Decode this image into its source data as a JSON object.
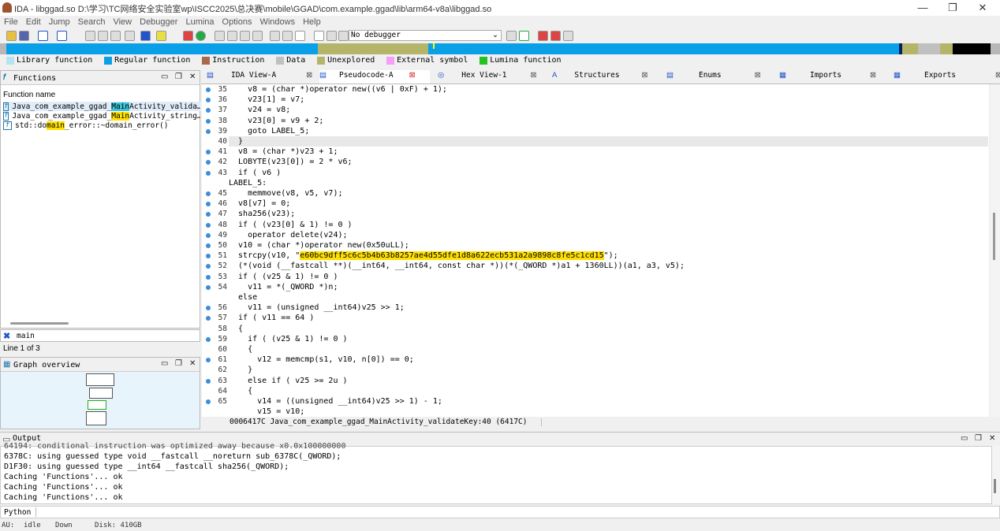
{
  "window": {
    "title": "IDA - libggad.so D:\\学习\\TC网络安全实验室wp\\ISCC2025\\总决赛\\mobile\\GGAD\\com.example.ggad\\lib\\arm64-v8a\\libggad.so",
    "min": "—",
    "max": "❐",
    "close": "✕"
  },
  "menu": [
    "File",
    "Edit",
    "Jump",
    "Search",
    "View",
    "Debugger",
    "Lumina",
    "Options",
    "Windows",
    "Help"
  ],
  "debugger_select": "No debugger",
  "legend": [
    {
      "label": "Library function",
      "color": "#b5e4f0"
    },
    {
      "label": "Regular function",
      "color": "#0aa0e8"
    },
    {
      "label": "Instruction",
      "color": "#a86a4a"
    },
    {
      "label": "Data",
      "color": "#c0c0c0"
    },
    {
      "label": "Unexplored",
      "color": "#b5b56a"
    },
    {
      "label": "External symbol",
      "color": "#f79ef7"
    },
    {
      "label": "Lumina function",
      "color": "#22c422"
    }
  ],
  "functions": {
    "title": "Functions",
    "column": "Function name",
    "items": [
      {
        "pre": "Java_com_example_ggad_",
        "hl": "Main",
        "post": "Activity_valida…",
        "hlclass": "hl-c"
      },
      {
        "pre": "Java_com_example_ggad_",
        "hl": "Main",
        "post": "Activity_string…",
        "hlclass": "hl-y"
      },
      {
        "pre": "std::do",
        "hl": "main",
        "post": "_error::~domain_error()",
        "hlclass": "hl-y"
      }
    ],
    "search": "main",
    "count": "Line 1 of 3"
  },
  "graph": {
    "title": "Graph overview"
  },
  "tabs": [
    "IDA View-A",
    "Pseudocode-A",
    "Hex View-1",
    "Structures",
    "Enums",
    "Imports",
    "Exports"
  ],
  "code": {
    "lines": [
      {
        "n": "35",
        "dot": true,
        "t": "    v8 = (char *)operator new((v6 | 0xF) + 1);"
      },
      {
        "n": "36",
        "dot": true,
        "t": "    v23[1] = v7;"
      },
      {
        "n": "37",
        "dot": true,
        "t": "    v24 = v8;"
      },
      {
        "n": "38",
        "dot": true,
        "t": "    v23[0] = v9 + 2;"
      },
      {
        "n": "39",
        "dot": true,
        "t": "    goto LABEL_5;"
      },
      {
        "n": "40",
        "dot": false,
        "t": "  }"
      },
      {
        "n": "41",
        "dot": true,
        "t": "  v8 = (char *)v23 + 1;"
      },
      {
        "n": "42",
        "dot": true,
        "t": "  LOBYTE(v23[0]) = 2 * v6;"
      },
      {
        "n": "43",
        "dot": true,
        "t": "  if ( v6 )"
      },
      {
        "n": "",
        "dot": false,
        "t": "LABEL_5:"
      },
      {
        "n": "45",
        "dot": true,
        "t": "    memmove(v8, v5, v7);"
      },
      {
        "n": "46",
        "dot": true,
        "t": "  v8[v7] = 0;"
      },
      {
        "n": "47",
        "dot": true,
        "t": "  sha256(v23);"
      },
      {
        "n": "48",
        "dot": true,
        "t": "  if ( (v23[0] & 1) != 0 )"
      },
      {
        "n": "49",
        "dot": true,
        "t": "    operator delete(v24);"
      },
      {
        "n": "50",
        "dot": true,
        "t": "  v10 = (char *)operator new(0x50uLL);"
      },
      {
        "n": "51",
        "dot": true,
        "t": "  strcpy(v10, \"",
        "hl": "e60bc9dff5c6c5b4b63b8257ae4d55dfe1d8a622ecb531a2a9898c8fe5c1cd15",
        "post": "\");"
      },
      {
        "n": "52",
        "dot": true,
        "t": "  (*(void (__fastcall **)(__int64, __int64, const char *))(*(_QWORD *)a1 + 1360LL))(a1, a3, v5);"
      },
      {
        "n": "53",
        "dot": true,
        "t": "  if ( (v25 & 1) != 0 )"
      },
      {
        "n": "54",
        "dot": true,
        "t": "    v11 = *(_QWORD *)n;"
      },
      {
        "n": "",
        "dot": false,
        "t": "  else"
      },
      {
        "n": "56",
        "dot": true,
        "t": "    v11 = (unsigned __int64)v25 >> 1;"
      },
      {
        "n": "57",
        "dot": true,
        "t": "  if ( v11 == 64 )"
      },
      {
        "n": "58",
        "dot": false,
        "t": "  {"
      },
      {
        "n": "59",
        "dot": true,
        "t": "    if ( (v25 & 1) != 0 )"
      },
      {
        "n": "60",
        "dot": false,
        "t": "    {"
      },
      {
        "n": "61",
        "dot": true,
        "t": "      v12 = memcmp(s1, v10, n[0]) == 0;"
      },
      {
        "n": "62",
        "dot": false,
        "t": "    }"
      },
      {
        "n": "63",
        "dot": true,
        "t": "    else if ( v25 >= 2u )"
      },
      {
        "n": "64",
        "dot": false,
        "t": "    {"
      },
      {
        "n": "65",
        "dot": true,
        "t": "      v14 = ((unsigned __int64)v25 >> 1) - 1;"
      },
      {
        "n": "",
        "dot": false,
        "t": "      v15 = v10;"
      }
    ],
    "status": "0006417C Java_com_example_ggad_MainActivity_validateKey:40 (6417C)"
  },
  "output": {
    "title": "Output",
    "lines": [
      "64194: conditional instruction was optimized away because x0.0x100000000",
      "6378C: using guessed type void __fastcall __noreturn sub_6378C(_QWORD);",
      "D1F30: using guessed type __int64 __fastcall sha256(_QWORD);",
      "Caching 'Functions'... ok",
      "Caching 'Functions'... ok",
      "Caching 'Functions'... ok"
    ]
  },
  "python": "Python",
  "status": {
    "au": "AU:",
    "state": "idle",
    "dir": "Down",
    "disk": "Disk: 410GB"
  }
}
